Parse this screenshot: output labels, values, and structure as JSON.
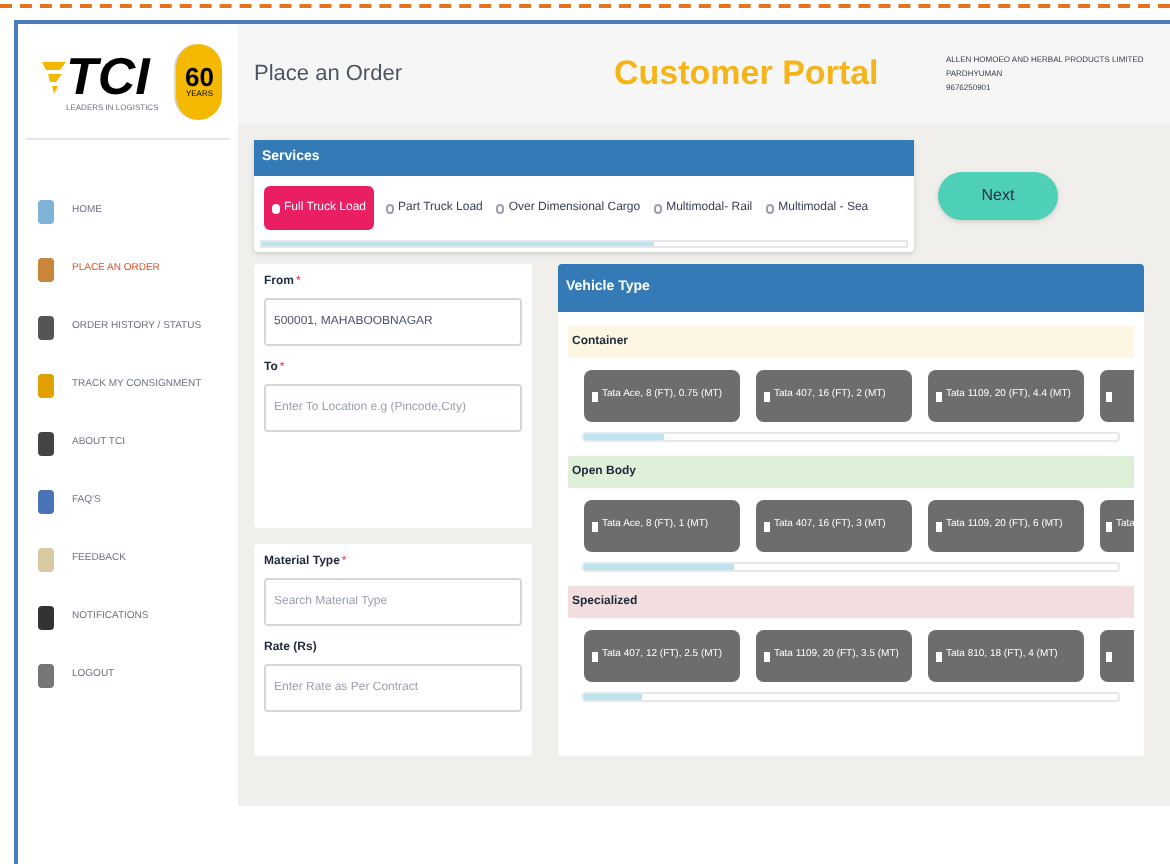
{
  "brand": {
    "logo": "TCI",
    "tagline": "LEADERS IN LOGISTICS",
    "badge_number": "60",
    "badge_text": "YEARS"
  },
  "header": {
    "page_title": "Place an Order",
    "portal_title": "Customer Portal",
    "account_lines": [
      "ALLEN HOMOEO AND HERBAL PRODUCTS LIMITED",
      "PARDHYUMAN",
      "9676250901"
    ]
  },
  "sidebar": {
    "items": [
      {
        "label": "HOME",
        "selected": false
      },
      {
        "label": "PLACE AN ORDER",
        "selected": true
      },
      {
        "label": "ORDER HISTORY / STATUS",
        "selected": false
      },
      {
        "label": "TRACK MY CONSIGNMENT",
        "selected": false
      },
      {
        "label": "ABOUT TCI",
        "selected": false
      },
      {
        "label": "FAQ'S",
        "selected": false
      },
      {
        "label": "FEEDBACK",
        "selected": false
      },
      {
        "label": "NOTIFICATIONS",
        "selected": false
      },
      {
        "label": "LOGOUT",
        "selected": false
      }
    ]
  },
  "services": {
    "title": "Services",
    "options": [
      {
        "label": "Full Truck Load",
        "selected": true
      },
      {
        "label": "Part Truck Load",
        "selected": false
      },
      {
        "label": "Over Dimensional Cargo",
        "selected": false
      },
      {
        "label": "Multimodal- Rail",
        "selected": false
      },
      {
        "label": "Multimodal - Sea",
        "selected": false
      }
    ]
  },
  "next_button": "Next",
  "route": {
    "from_label": "From",
    "from_required": "*",
    "from_value": "500001, MAHABOOBNAGAR",
    "to_label": "To",
    "to_required": "*",
    "to_placeholder": "Enter To Location e.g (Pincode,City)"
  },
  "material": {
    "type_label": "Material Type",
    "type_required": "*",
    "type_placeholder": "Search Material Type",
    "rate_label": "Rate (Rs)",
    "rate_placeholder": "Enter Rate as Per Contract"
  },
  "vehicle_type": {
    "title": "Vehicle Type",
    "groups": [
      {
        "name": "Container",
        "color": "#fcf6e3",
        "chips": [
          "Tata Ace, 8 (FT), 0.75 (MT)",
          "Tata 407, 16 (FT), 2 (MT)",
          "Tata 1109, 20 (FT), 4.4 (MT)"
        ]
      },
      {
        "name": "Open Body",
        "color": "#dff0d8",
        "chips": [
          "Tata Ace, 8 (FT), 1 (MT)",
          "Tata 407, 16 (FT), 3 (MT)",
          "Tata 1109, 20 (FT), 6 (MT)"
        ],
        "partial_chip": "Tata"
      },
      {
        "name": "Specialized",
        "color": "#f2dede",
        "chips": [
          "Tata 407, 12 (FT), 2.5 (MT)",
          "Tata 1109, 20 (FT), 3.5 (MT)",
          "Tata 810, 18 (FT), 4 (MT)"
        ]
      }
    ]
  }
}
